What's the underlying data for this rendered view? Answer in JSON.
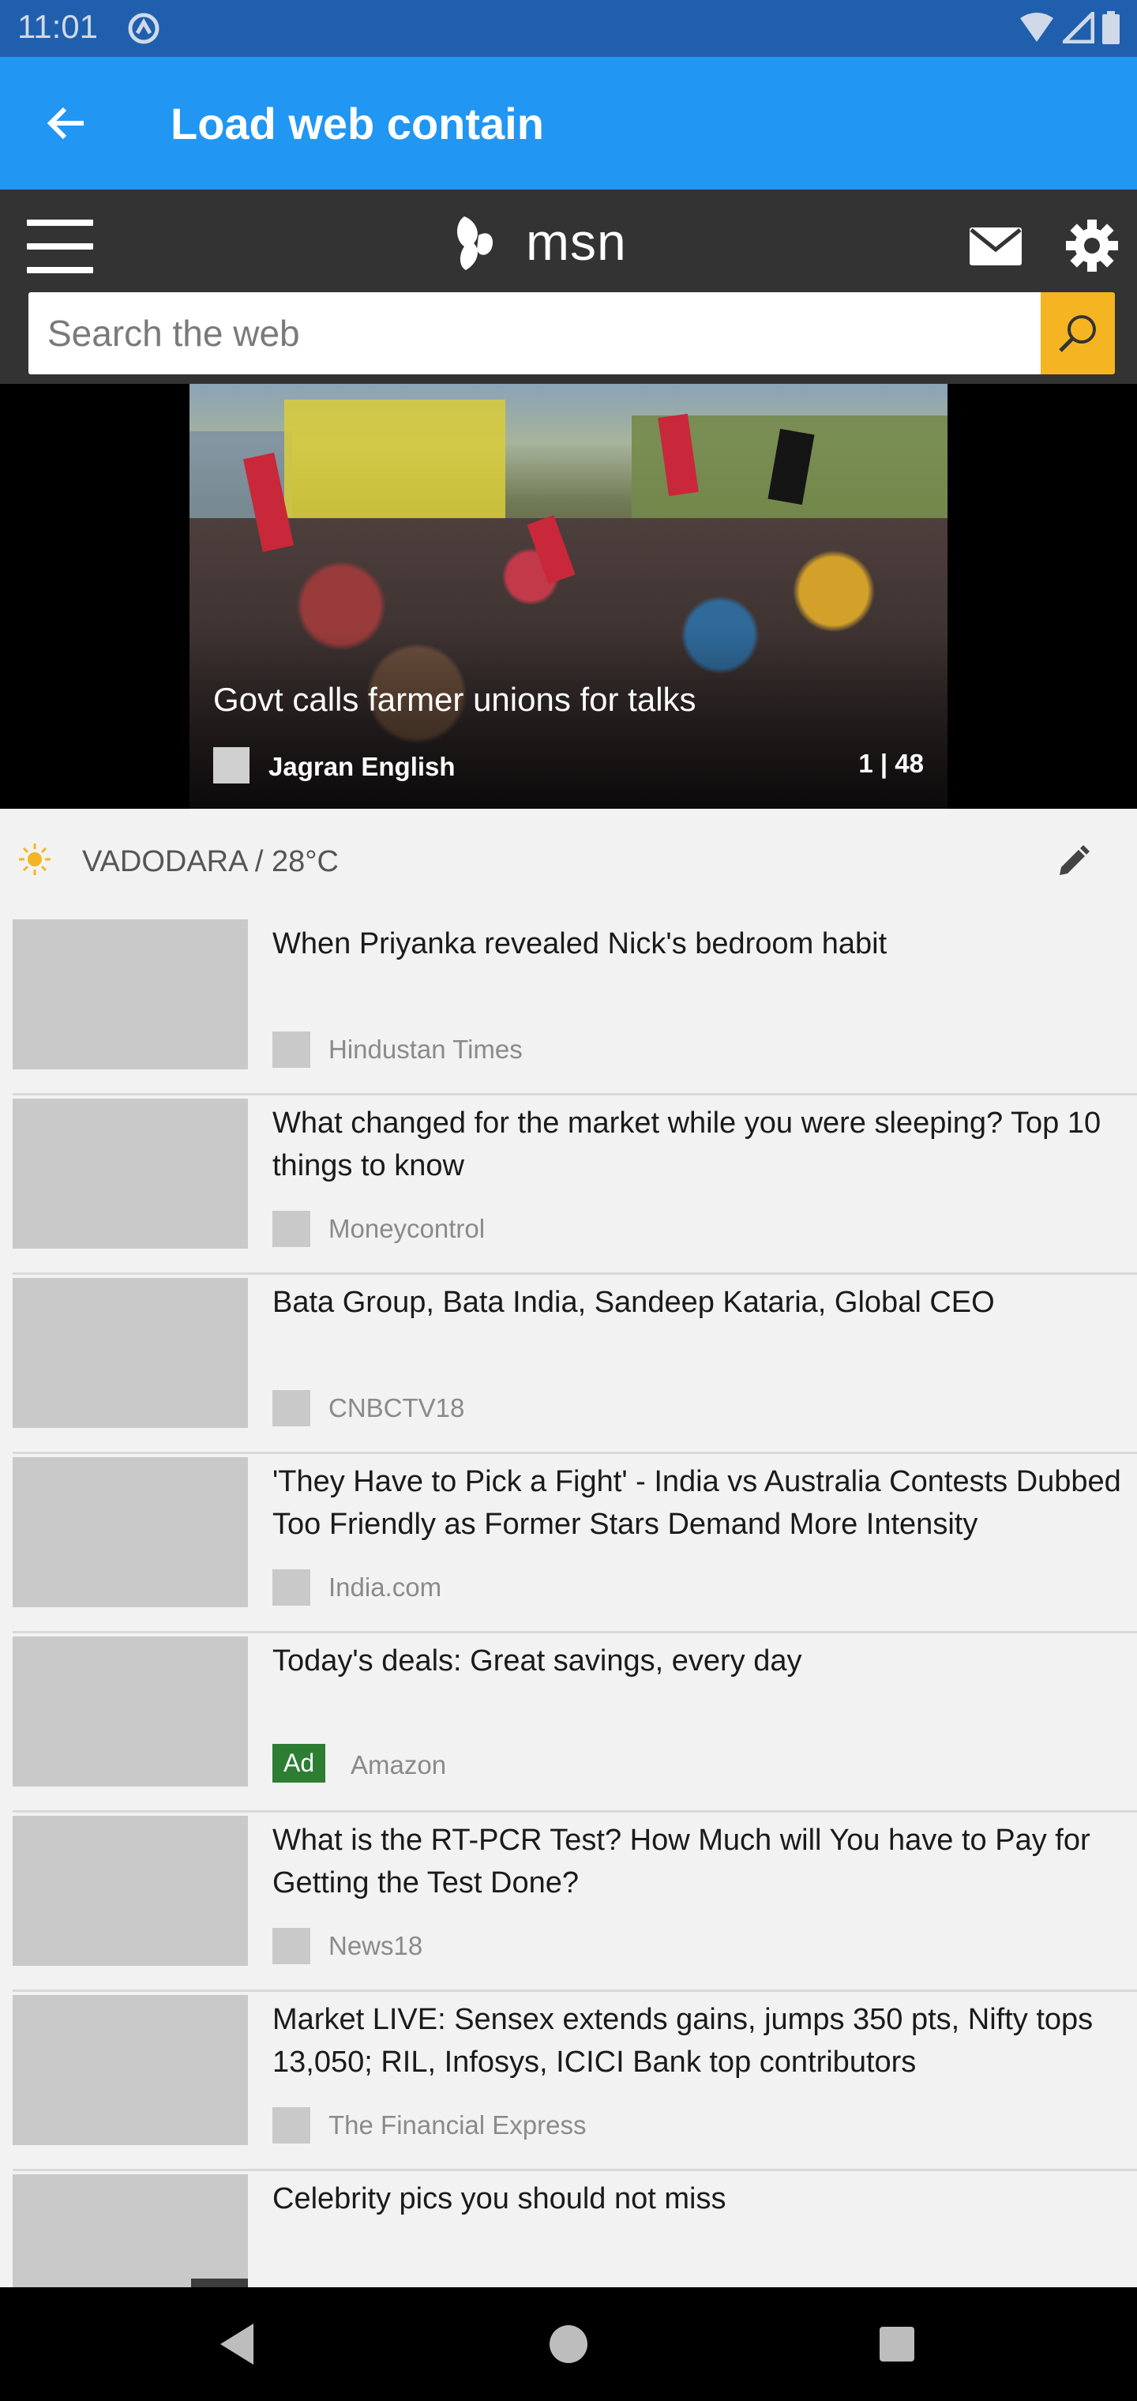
{
  "status_bar": {
    "time": "11:01"
  },
  "app_bar": {
    "title": "Load web contain"
  },
  "msn": {
    "brand": "msn",
    "search_placeholder": "Search the web",
    "accent_color": "#f5b522"
  },
  "hero": {
    "title": "Govt calls farmer unions for talks",
    "source": "Jagran English",
    "counter": "1 | 48"
  },
  "weather": {
    "text": "VADODARA / 28°C"
  },
  "feed": {
    "items": [
      {
        "title": "When Priyanka revealed Nick's bedroom habit",
        "source": "Hindustan Times"
      },
      {
        "title": "What changed for the market while you were sleeping? Top 10 things to know",
        "source": "Moneycontrol"
      },
      {
        "title": "Bata Group, Bata India, Sandeep Kataria, Global CEO",
        "source": "CNBCTV18"
      },
      {
        "title": "'They Have to Pick a Fight' - India vs Australia Contests Dubbed Too Friendly as Former Stars Demand More Intensity",
        "source": "India.com"
      },
      {
        "title": "Today's deals: Great savings, every day",
        "ad_label": "Ad",
        "source": "Amazon"
      },
      {
        "title": "What is the RT-PCR Test? How Much will You have to Pay for Getting the Test Done?",
        "source": "News18"
      },
      {
        "title": "Market LIVE: Sensex extends gains, jumps 350 pts, Nifty tops 13,050; RIL, Infosys, ICICI Bank top contributors",
        "source": "The Financial Express"
      },
      {
        "title": "Celebrity pics you should not miss"
      }
    ]
  },
  "colors": {
    "app_bar": "#2196f3",
    "status_bar": "#1f5fae",
    "msn_header": "#333333",
    "ad_badge": "#2d7d32"
  }
}
